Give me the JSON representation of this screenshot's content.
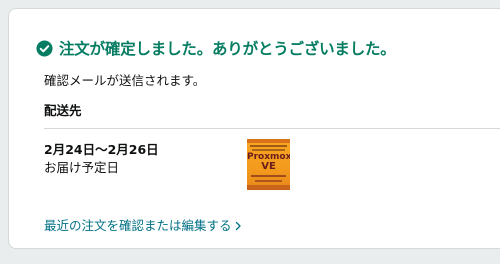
{
  "confirmation": {
    "title": "注文が確定しました。ありがとうございました。",
    "email_note": "確認メールが送信されます。",
    "ship_label": "配送先"
  },
  "delivery": {
    "date_range": "2月24日～2月26日",
    "label": "お届け予定日"
  },
  "product_thumbnail": {
    "title_text": "Proxmox",
    "subtitle_text": "VE"
  },
  "links": {
    "review_orders": "最近の注文を確認または編集する"
  },
  "colors": {
    "success_green": "#067d62",
    "link_teal": "#007185",
    "page_background": "#eaeded",
    "book_orange": "#f39a1c"
  },
  "icons": {
    "title_icon": "check-circle-icon",
    "link_icon": "chevron-right-icon"
  }
}
